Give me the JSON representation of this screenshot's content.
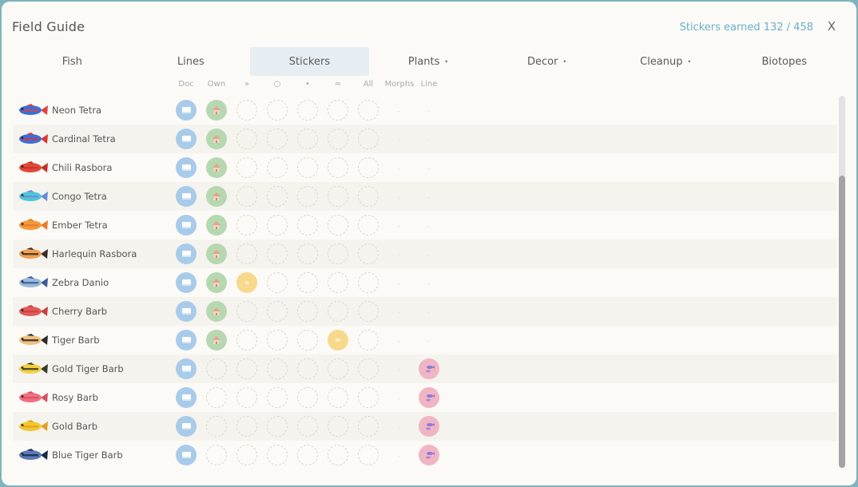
{
  "header": {
    "title": "Field Guide",
    "earned_label": "Stickers earned 132 / 458",
    "close_label": "X"
  },
  "tabs": [
    {
      "label": "Fish",
      "dot": "",
      "active": false
    },
    {
      "label": "Lines",
      "dot": "",
      "active": false
    },
    {
      "label": "Stickers",
      "dot": "",
      "active": true
    },
    {
      "label": "Plants",
      "dot": "•",
      "active": false
    },
    {
      "label": "Decor",
      "dot": "•",
      "active": false
    },
    {
      "label": "Cleanup",
      "dot": "•",
      "active": false
    },
    {
      "label": "Biotopes",
      "dot": "",
      "active": false
    }
  ],
  "columns": [
    "Doc",
    "Own",
    "»",
    "○",
    "•",
    "≈",
    "All",
    "Morphs",
    "Line"
  ],
  "yellow_glyphs": {
    "2": "»",
    "5": "≈"
  },
  "rows": [
    {
      "name": "Neon Tetra",
      "colors": [
        "#3a6fd8",
        "#e0433c"
      ],
      "cells": [
        "doc",
        "own",
        "",
        "",
        "",
        "",
        ""
      ],
      "morphs": "-",
      "line": "-"
    },
    {
      "name": "Cardinal Tetra",
      "colors": [
        "#3a6fd8",
        "#d8363b"
      ],
      "cells": [
        "doc",
        "own",
        "",
        "",
        "",
        "",
        ""
      ],
      "morphs": "-",
      "line": "-"
    },
    {
      "name": "Chili Rasbora",
      "colors": [
        "#e04a3a",
        "#c83020"
      ],
      "cells": [
        "doc",
        "own",
        "",
        "",
        "",
        "",
        ""
      ],
      "morphs": "-",
      "line": "-"
    },
    {
      "name": "Congo Tetra",
      "colors": [
        "#4fc6d8",
        "#6a8ad8"
      ],
      "cells": [
        "doc",
        "own",
        "",
        "",
        "",
        "",
        ""
      ],
      "morphs": "-",
      "line": "-"
    },
    {
      "name": "Ember Tetra",
      "colors": [
        "#f29a3a",
        "#e87a2a"
      ],
      "cells": [
        "doc",
        "own",
        "",
        "",
        "",
        "",
        ""
      ],
      "morphs": "-",
      "line": "-"
    },
    {
      "name": "Harlequin Rasbora",
      "colors": [
        "#f0a050",
        "#3a2a2a"
      ],
      "cells": [
        "doc",
        "own",
        "",
        "",
        "",
        "",
        ""
      ],
      "morphs": "-",
      "line": "-"
    },
    {
      "name": "Zebra Danio",
      "colors": [
        "#9ab8d8",
        "#3a5a9a"
      ],
      "cells": [
        "doc",
        "own",
        "yellow",
        "",
        "",
        "",
        ""
      ],
      "morphs": "-",
      "line": "-"
    },
    {
      "name": "Cherry Barb",
      "colors": [
        "#e05a5a",
        "#c84040"
      ],
      "cells": [
        "doc",
        "own",
        "",
        "",
        "",
        "",
        ""
      ],
      "morphs": "-",
      "line": "-"
    },
    {
      "name": "Tiger Barb",
      "colors": [
        "#f2c080",
        "#2a2a2a"
      ],
      "cells": [
        "doc",
        "own",
        "",
        "",
        "",
        "yellow",
        ""
      ],
      "morphs": "-",
      "line": "-"
    },
    {
      "name": "Gold Tiger Barb",
      "colors": [
        "#f2d040",
        "#3a3a2a"
      ],
      "cells": [
        "doc",
        "",
        "",
        "",
        "",
        "",
        ""
      ],
      "morphs": "-",
      "line": "line"
    },
    {
      "name": "Rosy Barb",
      "colors": [
        "#f07080",
        "#d85060"
      ],
      "cells": [
        "doc",
        "",
        "",
        "",
        "",
        "",
        ""
      ],
      "morphs": "-",
      "line": "line"
    },
    {
      "name": "Gold Barb",
      "colors": [
        "#f2c830",
        "#e0a020"
      ],
      "cells": [
        "doc",
        "",
        "",
        "",
        "",
        "",
        ""
      ],
      "morphs": "-",
      "line": "line"
    },
    {
      "name": "Blue Tiger Barb",
      "colors": [
        "#5a7ab8",
        "#1a2a4a"
      ],
      "cells": [
        "doc",
        "",
        "",
        "",
        "",
        "",
        ""
      ],
      "morphs": "-",
      "line": "line"
    }
  ]
}
